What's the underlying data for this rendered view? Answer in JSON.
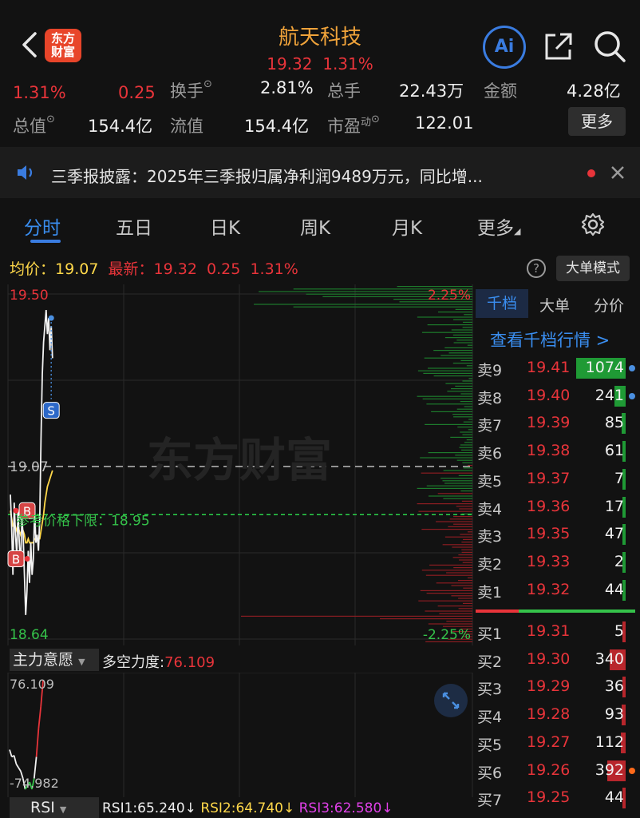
{
  "header": {
    "title": "航天科技",
    "price": "19.32",
    "change_pct": "1.31%",
    "logo_line1": "东方",
    "logo_line2": "财富",
    "ai_label": "Ai"
  },
  "stats": {
    "pct": "1.31%",
    "chg": "0.25",
    "turnover_label": "换手",
    "turnover_value": "2.81%",
    "volume_label": "总手",
    "volume_value": "22.43万",
    "amount_label": "金额",
    "amount_value": "4.28亿",
    "mktcap_label": "总值",
    "mktcap_value": "154.4亿",
    "float_label": "流值",
    "float_value": "154.4亿",
    "pe_label": "市盈",
    "pe_sup": "动",
    "pe_value": "122.01",
    "more_label": "更多"
  },
  "notice": {
    "text": "三季报披露：2025年三季报归属净利润9489万元，同比增..."
  },
  "tabs": [
    "分时",
    "五日",
    "日K",
    "周K",
    "月K",
    "更多"
  ],
  "chart_header": {
    "avg_label": "均价：",
    "avg_value": "19.07",
    "latest_label": "最新：",
    "latest_value": "19.32",
    "latest_chg": "0.25",
    "latest_pct": "1.31%",
    "big_order_mode": "大单模式",
    "help": "?"
  },
  "chart_data": {
    "type": "line",
    "ylim": [
      18.64,
      19.5
    ],
    "y_top_label": "19.50",
    "y_bottom_label": "18.64",
    "y_mid_label": "19.07",
    "pct_top_label": "2.25%",
    "pct_bottom_label": "-2.25%",
    "watermark": "东方财富",
    "lower_limit_label": "参考价格下限：18.95",
    "lower_limit_value": 18.95,
    "reference_value": 19.07,
    "price_series": [
      19.0,
      18.92,
      18.8,
      18.98,
      18.9,
      18.85,
      18.96,
      18.88,
      18.82,
      18.94,
      18.9,
      18.8,
      18.7,
      18.76,
      18.86,
      18.78,
      18.88,
      18.8,
      18.84,
      18.96,
      18.88,
      18.9,
      18.86,
      18.94,
      19.14,
      19.3,
      19.38,
      19.42,
      19.46,
      19.4,
      19.44,
      19.36,
      19.42,
      19.34
    ],
    "avg_series": [
      18.96,
      18.94,
      18.92,
      18.93,
      18.92,
      18.91,
      18.92,
      18.91,
      18.9,
      18.91,
      18.91,
      18.9,
      18.88,
      18.88,
      18.89,
      18.88,
      18.88,
      18.88,
      18.88,
      18.89,
      18.89,
      18.89,
      18.89,
      18.89,
      18.91,
      18.93,
      18.95,
      18.98,
      19.0,
      19.02,
      19.03,
      19.04,
      19.05,
      19.06
    ],
    "markers": [
      {
        "label": "B",
        "index": 6,
        "price": 18.96
      },
      {
        "label": "B",
        "index": 1,
        "price": 18.84
      },
      {
        "label": "S",
        "index": 23,
        "price": 19.21
      }
    ]
  },
  "orderbook": {
    "tabs": [
      "千档",
      "大单",
      "分价"
    ],
    "view_depth": "查看千档行情 >",
    "sell": [
      {
        "label": "卖9",
        "price": "19.41",
        "vol": "1074",
        "vol_num": 1074,
        "dot": "#4a8fe0"
      },
      {
        "label": "卖8",
        "price": "19.40",
        "vol": "241",
        "vol_num": 241,
        "dot": "#4a8fe0"
      },
      {
        "label": "卖7",
        "price": "19.39",
        "vol": "85",
        "vol_num": 85,
        "dot": ""
      },
      {
        "label": "卖6",
        "price": "19.38",
        "vol": "61",
        "vol_num": 61,
        "dot": ""
      },
      {
        "label": "卖5",
        "price": "19.37",
        "vol": "7",
        "vol_num": 7,
        "dot": ""
      },
      {
        "label": "卖4",
        "price": "19.36",
        "vol": "17",
        "vol_num": 17,
        "dot": ""
      },
      {
        "label": "卖3",
        "price": "19.35",
        "vol": "47",
        "vol_num": 47,
        "dot": ""
      },
      {
        "label": "卖2",
        "price": "19.33",
        "vol": "2",
        "vol_num": 2,
        "dot": ""
      },
      {
        "label": "卖1",
        "price": "19.32",
        "vol": "44",
        "vol_num": 44,
        "dot": ""
      }
    ],
    "buy": [
      {
        "label": "买1",
        "price": "19.31",
        "vol": "5",
        "vol_num": 5,
        "dot": ""
      },
      {
        "label": "买2",
        "price": "19.30",
        "vol": "340",
        "vol_num": 340,
        "dot": ""
      },
      {
        "label": "买3",
        "price": "19.29",
        "vol": "36",
        "vol_num": 36,
        "dot": ""
      },
      {
        "label": "买4",
        "price": "19.28",
        "vol": "93",
        "vol_num": 93,
        "dot": ""
      },
      {
        "label": "买5",
        "price": "19.27",
        "vol": "112",
        "vol_num": 112,
        "dot": ""
      },
      {
        "label": "买6",
        "price": "19.26",
        "vol": "392",
        "vol_num": 392,
        "dot": "#ff6a1a"
      },
      {
        "label": "买7",
        "price": "19.25",
        "vol": "44",
        "vol_num": 44,
        "dot": ""
      }
    ]
  },
  "indicator": {
    "name": "主力意愿",
    "label": "多空力度:",
    "value": "76.109",
    "max_label": "76.109",
    "min_label": "-74.982",
    "series": [
      -20,
      -30,
      -28,
      -40,
      -45,
      -50,
      -60,
      -75,
      -70,
      -65,
      -74.982,
      -60,
      -30,
      10,
      40,
      76.109
    ]
  },
  "rsi": {
    "name": "RSI",
    "rsi1": "RSI1:65.240",
    "rsi2": "RSI2:64.740",
    "rsi3": "RSI3:62.580",
    "arrow": "↓"
  },
  "colors": {
    "up": "#e8343a",
    "down": "#35c24a",
    "accent": "#3a7ce0",
    "title": "#f0a33a"
  }
}
